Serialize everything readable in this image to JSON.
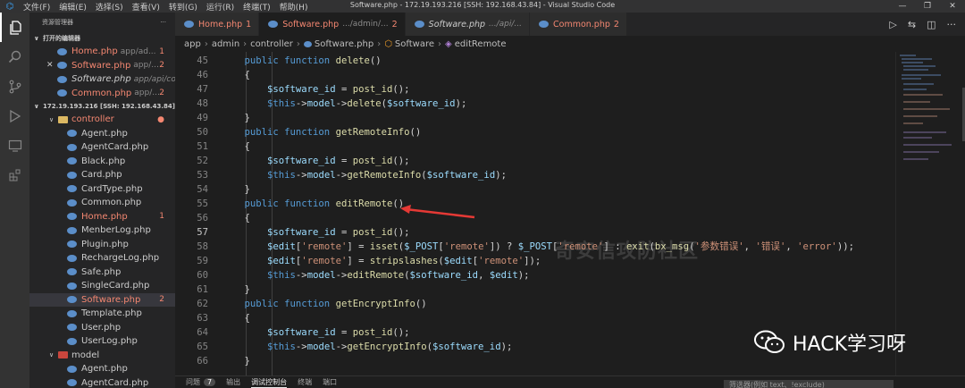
{
  "titlebar": {
    "menus": [
      "文件(F)",
      "编辑(E)",
      "选择(S)",
      "查看(V)",
      "转到(G)",
      "运行(R)",
      "终端(T)",
      "帮助(H)"
    ],
    "title": "Software.php - 172.19.193.216 [SSH: 192.168.43.84] - Visual Studio Code"
  },
  "sidebar": {
    "header": "资源管理器",
    "open_editors_label": "打开的编辑器",
    "open_editors": [
      {
        "name": "Home.php",
        "path": "app/ad...",
        "badge": "1",
        "error": true
      },
      {
        "name": "Software.php",
        "path": "app/...",
        "badge": "2",
        "error": true
      },
      {
        "name": "Software.php",
        "path": "app/api/co...",
        "badge": "",
        "error": false
      },
      {
        "name": "Common.php",
        "path": "app/...",
        "badge": "2",
        "error": true
      }
    ],
    "workspace_label": "172.19.193.216 [SSH: 192.168.43.84]",
    "controller_folder": "controller",
    "files": [
      {
        "name": "Agent.php",
        "badge": "",
        "error": false
      },
      {
        "name": "AgentCard.php",
        "badge": "",
        "error": false
      },
      {
        "name": "Black.php",
        "badge": "",
        "error": false
      },
      {
        "name": "Card.php",
        "badge": "",
        "error": false
      },
      {
        "name": "CardType.php",
        "badge": "",
        "error": false
      },
      {
        "name": "Common.php",
        "badge": "",
        "error": false
      },
      {
        "name": "Home.php",
        "badge": "1",
        "error": true
      },
      {
        "name": "MenberLog.php",
        "badge": "",
        "error": false
      },
      {
        "name": "Plugin.php",
        "badge": "",
        "error": false
      },
      {
        "name": "RechargeLog.php",
        "badge": "",
        "error": false
      },
      {
        "name": "Safe.php",
        "badge": "",
        "error": false
      },
      {
        "name": "SingleCard.php",
        "badge": "",
        "error": false
      },
      {
        "name": "Software.php",
        "badge": "2",
        "error": true
      },
      {
        "name": "Template.php",
        "badge": "",
        "error": false
      },
      {
        "name": "User.php",
        "badge": "",
        "error": false
      },
      {
        "name": "UserLog.php",
        "badge": "",
        "error": false
      }
    ],
    "model_folder": "model",
    "model_files": [
      "Agent.php",
      "AgentCard.php"
    ]
  },
  "tabs": [
    {
      "name": "Home.php",
      "path": "",
      "badge": "1",
      "kind": "err"
    },
    {
      "name": "Software.php",
      "path": ".../admin/...",
      "badge": "2",
      "kind": "act"
    },
    {
      "name": "Software.php",
      "path": ".../api/...",
      "badge": "",
      "kind": "it"
    },
    {
      "name": "Common.php",
      "path": "",
      "badge": "2",
      "kind": "err"
    }
  ],
  "breadcrumb": [
    "app",
    "admin",
    "controller",
    "Software.php",
    "Software",
    "editRemote"
  ],
  "code": [
    {
      "n": "45",
      "t": [
        [
          "    "
        ],
        [
          "public function ",
          "kw"
        ],
        [
          "delete",
          "fn"
        ],
        [
          "()"
        ]
      ]
    },
    {
      "n": "46",
      "t": [
        [
          "    {"
        ]
      ]
    },
    {
      "n": "47",
      "t": [
        [
          "        "
        ],
        [
          "$software_id",
          "vr"
        ],
        [
          " = "
        ],
        [
          "post_id",
          "fn"
        ],
        [
          "();"
        ]
      ]
    },
    {
      "n": "48",
      "t": [
        [
          "        "
        ],
        [
          "$this",
          "kw"
        ],
        [
          "->"
        ],
        [
          "model",
          "vr"
        ],
        [
          "->"
        ],
        [
          "delete",
          "fn"
        ],
        [
          "("
        ],
        [
          "$software_id",
          "vr"
        ],
        [
          ");"
        ]
      ]
    },
    {
      "n": "49",
      "t": [
        [
          "    }"
        ]
      ]
    },
    {
      "n": "50",
      "t": [
        [
          "    "
        ],
        [
          "public function ",
          "kw"
        ],
        [
          "getRemoteInfo",
          "fn"
        ],
        [
          "()"
        ]
      ]
    },
    {
      "n": "51",
      "t": [
        [
          "    {"
        ]
      ]
    },
    {
      "n": "52",
      "t": [
        [
          "        "
        ],
        [
          "$software_id",
          "vr"
        ],
        [
          " = "
        ],
        [
          "post_id",
          "fn"
        ],
        [
          "();"
        ]
      ]
    },
    {
      "n": "53",
      "t": [
        [
          "        "
        ],
        [
          "$this",
          "kw"
        ],
        [
          "->"
        ],
        [
          "model",
          "vr"
        ],
        [
          "->"
        ],
        [
          "getRemoteInfo",
          "fn"
        ],
        [
          "("
        ],
        [
          "$software_id",
          "vr"
        ],
        [
          ");"
        ]
      ]
    },
    {
      "n": "54",
      "t": [
        [
          "    }"
        ]
      ]
    },
    {
      "n": "55",
      "t": [
        [
          "    "
        ],
        [
          "public function ",
          "kw"
        ],
        [
          "editRemote",
          "fn"
        ],
        [
          "()"
        ]
      ]
    },
    {
      "n": "56",
      "t": [
        [
          "    {"
        ]
      ]
    },
    {
      "n": "57",
      "t": [
        [
          "        "
        ],
        [
          "$software_id",
          "vr"
        ],
        [
          " = "
        ],
        [
          "post_id",
          "fn"
        ],
        [
          "();"
        ]
      ]
    },
    {
      "n": "58",
      "t": [
        [
          "        "
        ],
        [
          "$edit",
          "vr"
        ],
        [
          "["
        ],
        [
          "'remote'",
          "st"
        ],
        [
          "] = "
        ],
        [
          "isset",
          "fn"
        ],
        [
          "("
        ],
        [
          "$_POST",
          "vr"
        ],
        [
          "["
        ],
        [
          "'remote'",
          "st"
        ],
        [
          "]) ? "
        ],
        [
          "$_POST",
          "vr"
        ],
        [
          "["
        ],
        [
          "'remote'",
          "st"
        ],
        [
          "] : "
        ],
        [
          "exit",
          "fn"
        ],
        [
          "("
        ],
        [
          "bx_msg",
          "fn"
        ],
        [
          "("
        ],
        [
          "'参数错误'",
          "st"
        ],
        [
          ", "
        ],
        [
          "'错误'",
          "st"
        ],
        [
          ", "
        ],
        [
          "'error'",
          "st"
        ],
        [
          "));"
        ]
      ]
    },
    {
      "n": "59",
      "t": [
        [
          "        "
        ],
        [
          "$edit",
          "vr"
        ],
        [
          "["
        ],
        [
          "'remote'",
          "st"
        ],
        [
          "] = "
        ],
        [
          "stripslashes",
          "fn"
        ],
        [
          "("
        ],
        [
          "$edit",
          "vr"
        ],
        [
          "["
        ],
        [
          "'remote'",
          "st"
        ],
        [
          "]);"
        ]
      ]
    },
    {
      "n": "60",
      "t": [
        [
          "        "
        ],
        [
          "$this",
          "kw"
        ],
        [
          "->"
        ],
        [
          "model",
          "vr"
        ],
        [
          "->"
        ],
        [
          "editRemote",
          "fn"
        ],
        [
          "("
        ],
        [
          "$software_id",
          "vr"
        ],
        [
          ", "
        ],
        [
          "$edit",
          "vr"
        ],
        [
          ");"
        ]
      ]
    },
    {
      "n": "61",
      "t": [
        [
          "    }"
        ]
      ]
    },
    {
      "n": "62",
      "t": [
        [
          "    "
        ],
        [
          "public function ",
          "kw"
        ],
        [
          "getEncryptInfo",
          "fn"
        ],
        [
          "()"
        ]
      ]
    },
    {
      "n": "63",
      "t": [
        [
          "    {"
        ]
      ]
    },
    {
      "n": "64",
      "t": [
        [
          "        "
        ],
        [
          "$software_id",
          "vr"
        ],
        [
          " = "
        ],
        [
          "post_id",
          "fn"
        ],
        [
          "();"
        ]
      ]
    },
    {
      "n": "65",
      "t": [
        [
          "        "
        ],
        [
          "$this",
          "kw"
        ],
        [
          "->"
        ],
        [
          "model",
          "vr"
        ],
        [
          "->"
        ],
        [
          "getEncryptInfo",
          "fn"
        ],
        [
          "("
        ],
        [
          "$software_id",
          "vr"
        ],
        [
          ");"
        ]
      ]
    },
    {
      "n": "66",
      "t": [
        [
          "    }"
        ]
      ]
    }
  ],
  "current_line": "57",
  "panel": {
    "problems": "问题",
    "problems_count": "7",
    "output": "输出",
    "debug": "调试控制台",
    "terminal": "终端",
    "ports": "端口",
    "filter_placeholder": "筛选器(例如 text、!exclude)"
  },
  "watermark": "奇安信攻防社区",
  "brand": "HACK学习呀",
  "colors": {
    "accent": "#007acc",
    "error": "#f48771",
    "annotation_arrow": "#e53935"
  }
}
